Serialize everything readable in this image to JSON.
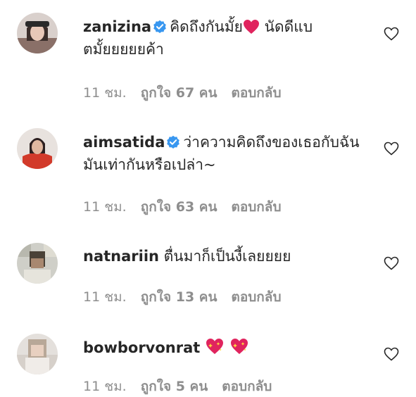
{
  "comments": [
    {
      "username": "zanizina",
      "verified": true,
      "text_before": "คิดถึงกันมั้ย",
      "text_after": " นัดดีแบตมั้ยยยยยค้า",
      "time": "11 ชม.",
      "likes": "ถูกใจ 67 คน",
      "reply": "ตอบกลับ"
    },
    {
      "username": "aimsatida",
      "verified": true,
      "text": "ว่าความคิดถึงของเธอกับฉัน มันเท่ากันหรือเปล่า~",
      "time": "11 ชม.",
      "likes": "ถูกใจ 63 คน",
      "reply": "ตอบกลับ"
    },
    {
      "username": "natnariin",
      "verified": false,
      "text": "ตื่นมาก็เป็นงี้เลยยยย",
      "time": "11 ชม.",
      "likes": "ถูกใจ 13 คน",
      "reply": "ตอบกลับ"
    },
    {
      "username": "bowborvonrat",
      "verified": false,
      "text": "",
      "time": "11 ชม.",
      "likes": "ถูกใจ 5 คน",
      "reply": "ตอบกลับ"
    }
  ],
  "colors": {
    "text": "#262626",
    "muted": "#8e8e8e",
    "verified": "#3897f0",
    "emoji_heart": "#e0245e"
  },
  "icons": [
    "verified-badge-icon",
    "heart-outline-icon",
    "red-heart-emoji-icon",
    "sparkling-heart-emoji-icon"
  ]
}
